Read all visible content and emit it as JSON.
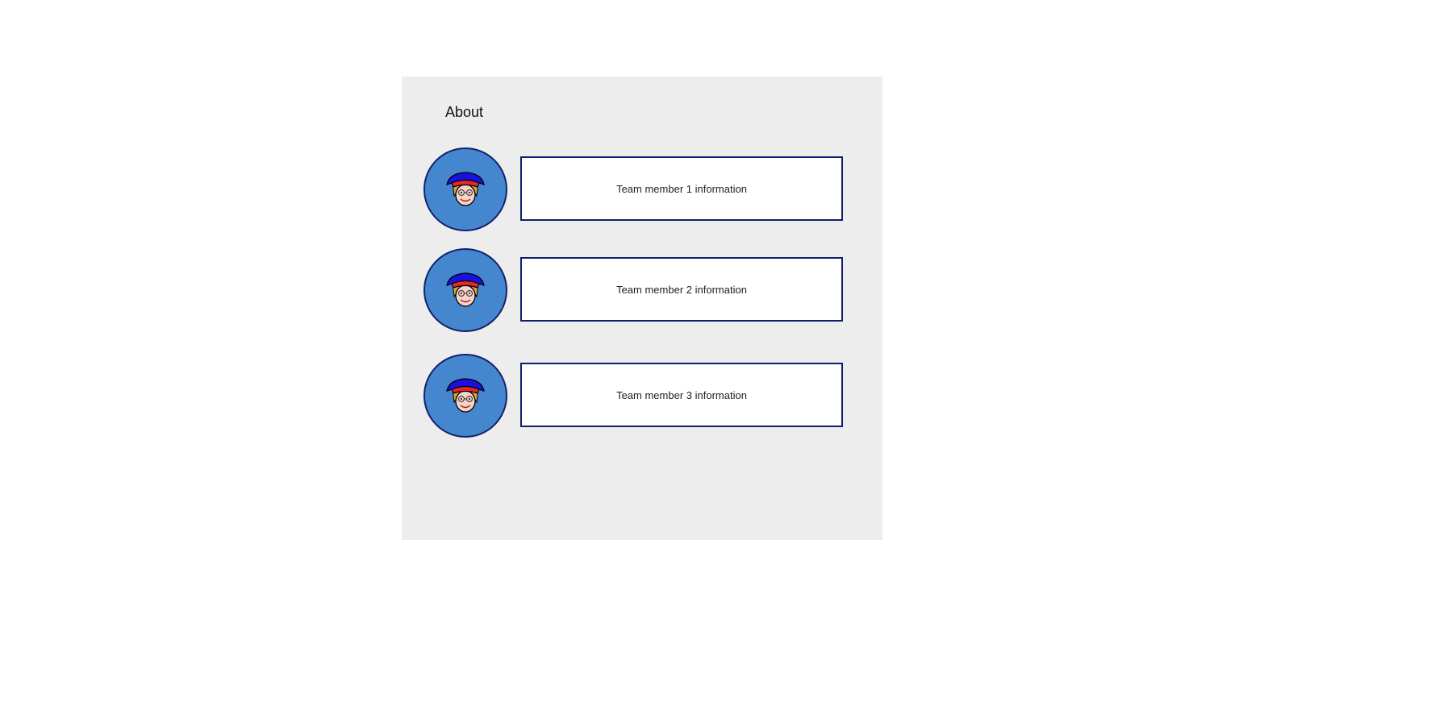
{
  "page": {
    "title": "About"
  },
  "members": [
    {
      "info": "Team member 1 information",
      "avatar_icon": "person-with-cap-icon"
    },
    {
      "info": "Team member 2 information",
      "avatar_icon": "person-with-cap-icon"
    },
    {
      "info": "Team member 3 information",
      "avatar_icon": "person-with-cap-icon"
    }
  ],
  "colors": {
    "panel_background": "#ededed",
    "avatar_background": "#4587cf",
    "border": "#0f1f6b",
    "cap_blue": "#1a10e0",
    "cap_red": "#e5262a"
  }
}
